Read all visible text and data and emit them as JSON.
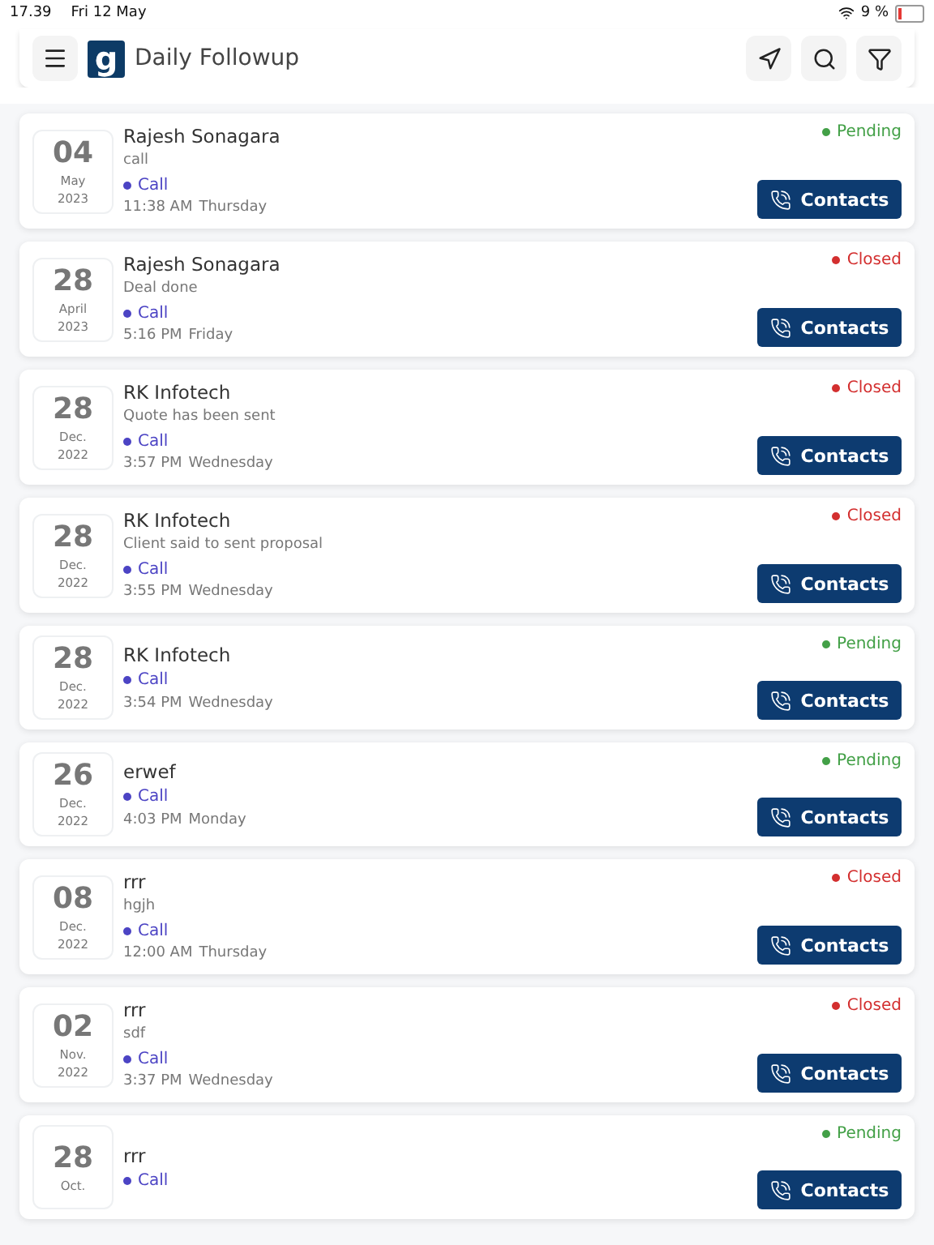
{
  "status_bar": {
    "time": "17.39",
    "date": "Fri 12 May",
    "battery": "9 %"
  },
  "header": {
    "logo_text": "g",
    "title": "Daily Followup"
  },
  "followups": [
    {
      "day": "04",
      "month": "May",
      "year": "2023",
      "name": "Rajesh Sonagara",
      "note": "call",
      "type": "Call",
      "time": "11:38 AM",
      "weekday": "Thursday",
      "status": {
        "label": "Pending",
        "color": "#43a047"
      },
      "button": "Contacts"
    },
    {
      "day": "28",
      "month": "April",
      "year": "2023",
      "name": "Rajesh Sonagara",
      "note": "Deal done",
      "type": "Call",
      "time": "5:16 PM",
      "weekday": "Friday",
      "status": {
        "label": "Closed",
        "color": "#d32f2f"
      },
      "button": "Contacts"
    },
    {
      "day": "28",
      "month": "Dec.",
      "year": "2022",
      "name": "RK Infotech",
      "note": "Quote has been sent",
      "type": "Call",
      "time": "3:57 PM",
      "weekday": "Wednesday",
      "status": {
        "label": "Closed",
        "color": "#d32f2f"
      },
      "button": "Contacts"
    },
    {
      "day": "28",
      "month": "Dec.",
      "year": "2022",
      "name": "RK Infotech",
      "note": "Client said to sent proposal",
      "type": "Call",
      "time": "3:55 PM",
      "weekday": "Wednesday",
      "status": {
        "label": "Closed",
        "color": "#d32f2f"
      },
      "button": "Contacts"
    },
    {
      "day": "28",
      "month": "Dec.",
      "year": "2022",
      "name": "RK Infotech",
      "type": "Call",
      "time": "3:54 PM",
      "weekday": "Wednesday",
      "status": {
        "label": "Pending",
        "color": "#43a047"
      },
      "button": "Contacts"
    },
    {
      "day": "26",
      "month": "Dec.",
      "year": "2022",
      "name": "erwef",
      "type": "Call",
      "time": "4:03 PM",
      "weekday": "Monday",
      "status": {
        "label": "Pending",
        "color": "#43a047"
      },
      "button": "Contacts"
    },
    {
      "day": "08",
      "month": "Dec.",
      "year": "2022",
      "name": "rrr",
      "note": "hgjh",
      "type": "Call",
      "time": "12:00 AM",
      "weekday": "Thursday",
      "status": {
        "label": "Closed",
        "color": "#d32f2f"
      },
      "button": "Contacts"
    },
    {
      "day": "02",
      "month": "Nov.",
      "year": "2022",
      "name": "rrr",
      "note": "sdf",
      "type": "Call",
      "time": "3:37 PM",
      "weekday": "Wednesday",
      "status": {
        "label": "Closed",
        "color": "#d32f2f"
      },
      "button": "Contacts"
    },
    {
      "day": "28",
      "month": "Oct.",
      "name": "rrr",
      "type": "Call",
      "status": {
        "label": "Pending",
        "color": "#43a047"
      },
      "button": "Contacts"
    }
  ]
}
